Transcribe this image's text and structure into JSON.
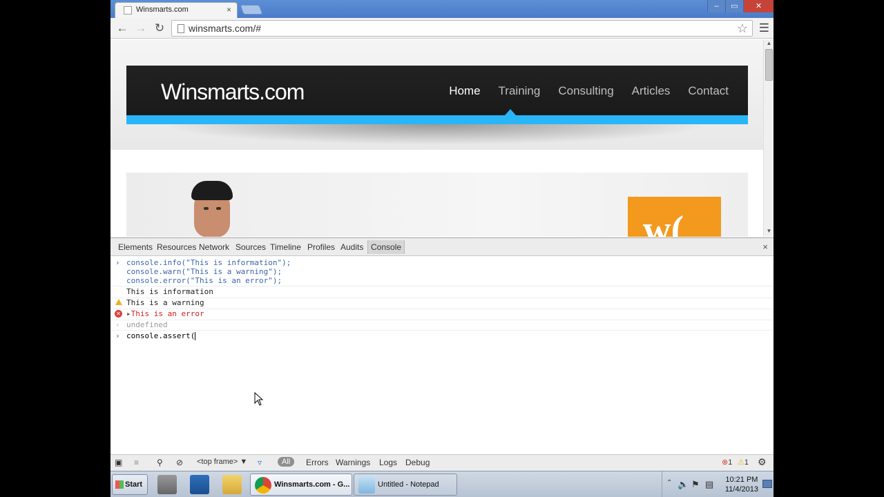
{
  "browser": {
    "tab_title": "Winsmarts.com",
    "tab_close": "×",
    "url": "winsmarts.com/#",
    "window_buttons": [
      "–",
      "▭",
      "✕"
    ]
  },
  "site": {
    "logo": "Winsmarts.com",
    "nav": [
      "Home",
      "Training",
      "Consulting",
      "Articles",
      "Contact"
    ],
    "active_nav": "Home",
    "accent_color": "#29b6f6",
    "orange_logo_text": "w(",
    "orange_color": "#f39a1e"
  },
  "devtools": {
    "tabs": [
      "Elements",
      "Resources",
      "Network",
      "Sources",
      "Timeline",
      "Profiles",
      "Audits",
      "Console"
    ],
    "active_tab": "Console",
    "close": "×"
  },
  "console": {
    "input_lines": [
      "console.info(\"This is information\");",
      "console.warn(\"This is a warning\");",
      "console.error(\"This is an error\");"
    ],
    "info_output": "This is information",
    "warn_output": "This is a warning",
    "error_output": "This is an error",
    "return_value": "undefined",
    "current_input": "console.assert("
  },
  "console_footer": {
    "frame_select": "<top frame>",
    "filter_all": "All",
    "filters": [
      "Errors",
      "Warnings",
      "Logs",
      "Debug"
    ],
    "error_count": "1",
    "warning_count": "1"
  },
  "taskbar": {
    "start": "Start",
    "tasks": [
      {
        "label": "Winsmarts.com - G...",
        "active": true
      },
      {
        "label": "Untitled - Notepad",
        "active": false
      }
    ],
    "clock_time": "10:21 PM",
    "clock_date": "11/4/2013"
  }
}
